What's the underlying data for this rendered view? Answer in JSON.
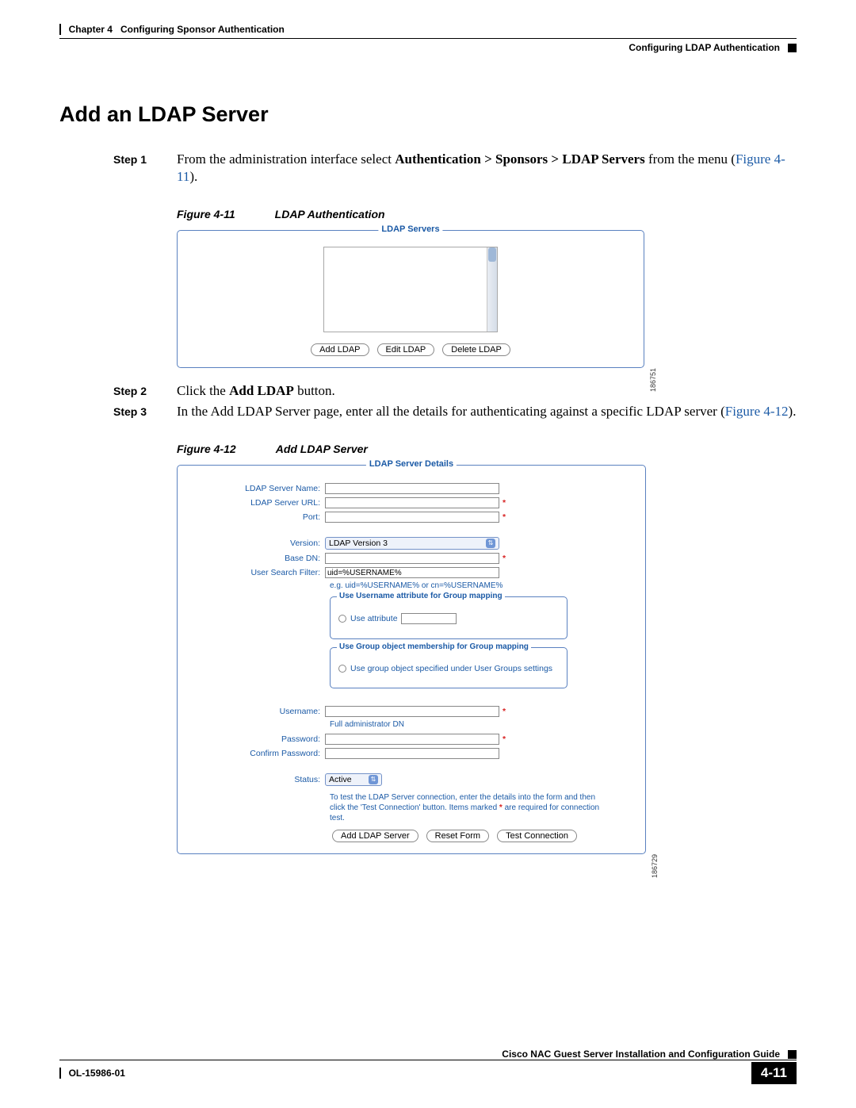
{
  "header": {
    "chapter": "Chapter 4",
    "title": "Configuring Sponsor Authentication",
    "subtitle": "Configuring LDAP Authentication"
  },
  "h1": "Add an LDAP Server",
  "steps": {
    "s1": {
      "label": "Step 1",
      "pre": "From the administration interface select ",
      "bold": "Authentication > Sponsors > LDAP Servers",
      "post": " from the menu (",
      "figref": "Figure 4-11",
      "close": ")."
    },
    "s2": {
      "label": "Step 2",
      "pre": "Click the ",
      "bold": "Add LDAP",
      "post": " button."
    },
    "s3": {
      "label": "Step 3",
      "pre": "In the Add LDAP Server page, enter all the details for authenticating against a specific LDAP server (",
      "figref": "Figure 4-12",
      "close": ")."
    }
  },
  "fig11": {
    "caption_num": "Figure 4-11",
    "caption_title": "LDAP Authentication",
    "fieldset_title": "LDAP Servers",
    "btn_add": "Add LDAP",
    "btn_edit": "Edit LDAP",
    "btn_delete": "Delete LDAP",
    "imgid": "186751"
  },
  "fig12": {
    "caption_num": "Figure 4-12",
    "caption_title": "Add LDAP Server",
    "fieldset_title": "LDAP Server Details",
    "labels": {
      "name": "LDAP Server Name:",
      "url": "LDAP Server URL:",
      "port": "Port:",
      "version": "Version:",
      "basedn": "Base DN:",
      "filter": "User Search Filter:",
      "username": "Username:",
      "password": "Password:",
      "confirm": "Confirm Password:",
      "status": "Status:"
    },
    "version_value": "LDAP Version 3",
    "filter_value": "uid=%USERNAME%",
    "filter_hint": "e.g. uid=%USERNAME% or cn=%USERNAME%",
    "fs_user_attr": "Use Username attribute for Group mapping",
    "radio_use_attr": "Use attribute",
    "fs_group_obj": "Use Group object membership for Group mapping",
    "radio_group_obj": "Use group object specified under User Groups settings",
    "username_hint": "Full administrator DN",
    "status_value": "Active",
    "test_hint_1": "To test the LDAP Server connection, enter the details into the form and then click the 'Test Connection' button. Items marked ",
    "test_hint_2": " are required for connection test.",
    "btn_add": "Add LDAP Server",
    "btn_reset": "Reset Form",
    "btn_test": "Test Connection",
    "imgid": "186729"
  },
  "footer": {
    "guide": "Cisco NAC Guest Server Installation and Configuration Guide",
    "doc": "OL-15986-01",
    "pagenum": "4-11"
  }
}
